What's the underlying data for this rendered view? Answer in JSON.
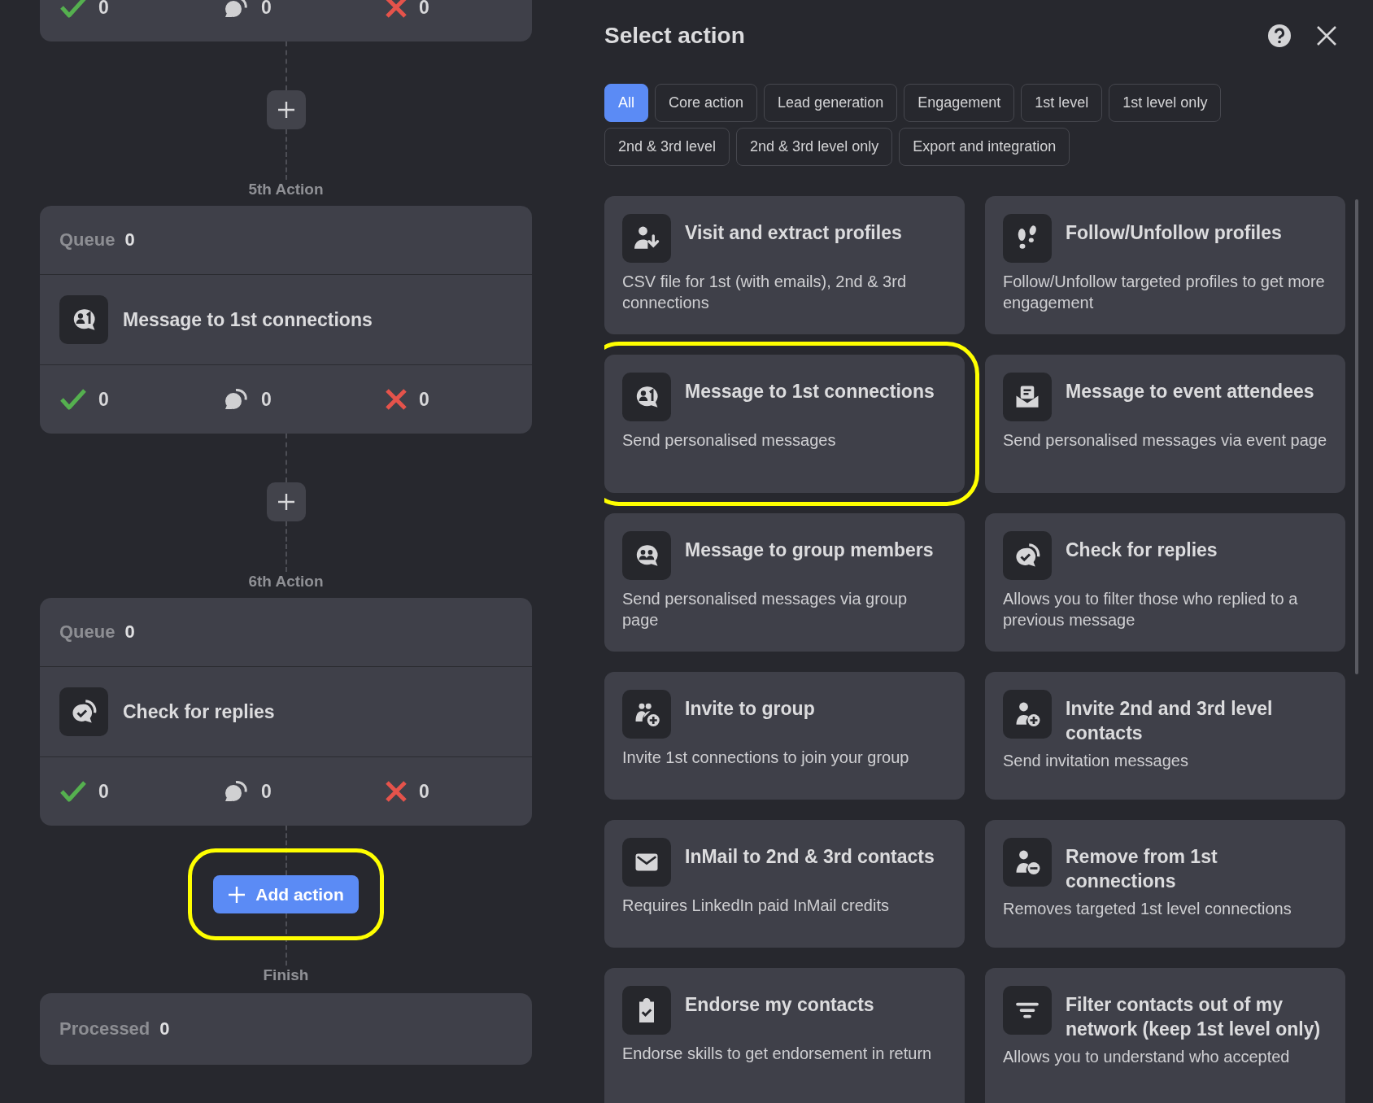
{
  "flow": {
    "top_stats": [
      {
        "kind": "accepted",
        "value": "0"
      },
      {
        "kind": "replied",
        "value": "0"
      },
      {
        "kind": "declined",
        "value": "0"
      }
    ],
    "steps": [
      {
        "label": "5th Action",
        "queue_label": "Queue",
        "queue": "0",
        "action": "Message to 1st connections",
        "kind": "message-person",
        "stats": [
          {
            "kind": "accepted",
            "value": "0"
          },
          {
            "kind": "replied",
            "value": "0"
          },
          {
            "kind": "declined",
            "value": "0"
          }
        ]
      },
      {
        "label": "6th Action",
        "queue_label": "Queue",
        "queue": "0",
        "action": "Check for replies",
        "kind": "reply-check",
        "stats": [
          {
            "kind": "accepted",
            "value": "0"
          },
          {
            "kind": "replied",
            "value": "0"
          },
          {
            "kind": "declined",
            "value": "0"
          }
        ]
      }
    ],
    "add_action": {
      "label": "Add action",
      "highlighted": true
    },
    "finish": {
      "label": "Finish",
      "processed_label": "Processed",
      "processed": "0"
    }
  },
  "panel": {
    "title": "Select action",
    "filters": [
      {
        "label": "All",
        "selected": true
      },
      {
        "label": "Core action",
        "selected": false
      },
      {
        "label": "Lead generation",
        "selected": false
      },
      {
        "label": "Engagement",
        "selected": false
      },
      {
        "label": "1st level",
        "selected": false
      },
      {
        "label": "1st level only",
        "selected": false
      },
      {
        "label": "2nd & 3rd level",
        "selected": false
      },
      {
        "label": "2nd & 3rd level only",
        "selected": false
      },
      {
        "label": "Export and integration",
        "selected": false
      }
    ],
    "actions": [
      {
        "title": "Visit and extract profiles",
        "description": "CSV file for 1st (with emails), 2nd & 3rd connections",
        "kind": "person-download",
        "highlighted": false
      },
      {
        "title": "Follow/Unfollow profiles",
        "description": "Follow/Unfollow targeted profiles to get more engagement",
        "kind": "footprints",
        "highlighted": false
      },
      {
        "title": "Message to 1st connections",
        "description": "Send personalised messages",
        "kind": "message-person",
        "highlighted": true
      },
      {
        "title": "Message to event attendees",
        "description": "Send personalised messages via event page",
        "kind": "event-message",
        "highlighted": false
      },
      {
        "title": "Message to group members",
        "description": "Send personalised messages via group page",
        "kind": "message-group",
        "highlighted": false
      },
      {
        "title": "Check for replies",
        "description": "Allows you to filter those who replied to a previous message",
        "kind": "reply-check",
        "highlighted": false
      },
      {
        "title": "Invite to group",
        "description": "Invite 1st connections to join your group",
        "kind": "group-add",
        "highlighted": false
      },
      {
        "title": "Invite 2nd and 3rd level contacts",
        "description": "Send invitation messages",
        "kind": "person-add",
        "highlighted": false
      },
      {
        "title": "InMail to 2nd & 3rd contacts",
        "description": "Requires LinkedIn paid InMail credits",
        "kind": "envelope",
        "highlighted": false
      },
      {
        "title": "Remove from 1st connections",
        "description": "Removes targeted 1st level connections",
        "kind": "person-remove",
        "highlighted": false
      },
      {
        "title": "Endorse my contacts",
        "description": "Endorse skills to get endorsement in return",
        "kind": "clipboard-check",
        "highlighted": false
      },
      {
        "title": "Filter contacts out of my network (keep 1st level only)",
        "description": "Allows you to understand who accepted",
        "kind": "filter",
        "highlighted": false
      }
    ]
  }
}
